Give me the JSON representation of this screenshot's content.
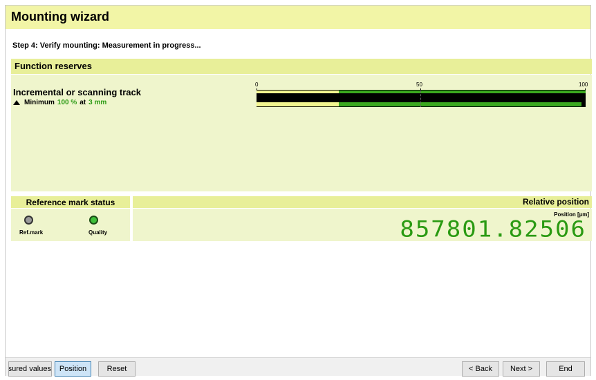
{
  "wizard": {
    "title": "Mounting wizard",
    "step_text": "Step 4: Verify mounting: Measurement in progress..."
  },
  "function_reserves": {
    "header": "Function reserves",
    "track_label": "Incremental or scanning track",
    "minimum": {
      "prefix": "Minimum",
      "percent": "100 %",
      "at": "at",
      "distance": "3 mm"
    },
    "scale": {
      "ticks": [
        "0",
        "50",
        "100"
      ],
      "level_fraction": 0.25
    }
  },
  "reference_mark": {
    "header": "Reference mark status",
    "ref_label": "Ref.mark",
    "quality_label": "Quality"
  },
  "relative_position": {
    "header": "Relative position",
    "unit_label": "Position [µm]",
    "value": "857801.82506"
  },
  "footer": {
    "measured_values": "Measured values",
    "position": "Position",
    "reset": "Reset",
    "back": "< Back",
    "next": "Next >",
    "end": "End"
  },
  "colors": {
    "title_bg": "#f2f5a6",
    "header_bg": "#e8ef99",
    "panel_bg": "#eff5cc",
    "green": "#2a9a12"
  }
}
